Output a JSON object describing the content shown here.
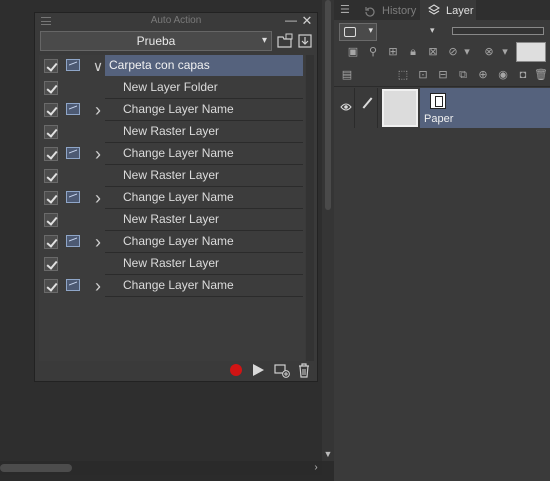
{
  "auto_action": {
    "title": "Auto Action",
    "set_name": "Prueba",
    "rows": [
      {
        "label": "Carpeta con capas",
        "has_dialog_icon": true,
        "expander": "v",
        "selected": true
      },
      {
        "label": "New Layer Folder",
        "has_dialog_icon": false,
        "expander": ""
      },
      {
        "label": "Change Layer Name",
        "has_dialog_icon": true,
        "expander": ">"
      },
      {
        "label": "New Raster Layer",
        "has_dialog_icon": false,
        "expander": ""
      },
      {
        "label": "Change Layer Name",
        "has_dialog_icon": true,
        "expander": ">"
      },
      {
        "label": "New Raster Layer",
        "has_dialog_icon": false,
        "expander": ""
      },
      {
        "label": "Change Layer Name",
        "has_dialog_icon": true,
        "expander": ">"
      },
      {
        "label": "New Raster Layer",
        "has_dialog_icon": false,
        "expander": ""
      },
      {
        "label": "Change Layer Name",
        "has_dialog_icon": true,
        "expander": ">"
      },
      {
        "label": "New Raster Layer",
        "has_dialog_icon": false,
        "expander": ""
      },
      {
        "label": "Change Layer Name",
        "has_dialog_icon": true,
        "expander": ">"
      }
    ],
    "record_color": "#d11414"
  },
  "layer_panel": {
    "tabs": [
      {
        "label": "History",
        "active": false
      },
      {
        "label": "Layer",
        "active": true
      }
    ],
    "layers": [
      {
        "name": "Paper",
        "selected": true
      }
    ],
    "selection_color": "#55627d"
  }
}
